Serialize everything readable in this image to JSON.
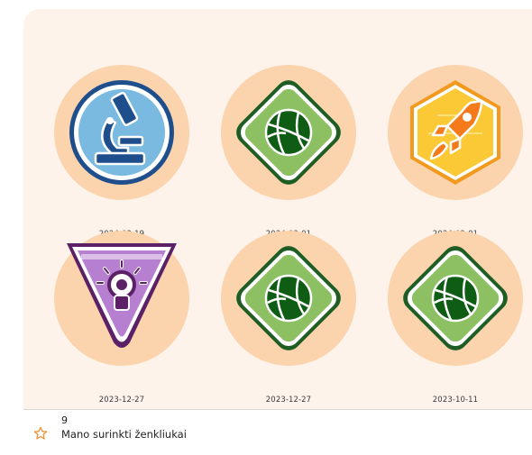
{
  "badges": [
    {
      "date": "2024-03-19",
      "icon": "microscope-icon"
    },
    {
      "date": "2024-03-01",
      "icon": "basketball-icon"
    },
    {
      "date": "2024-02-01",
      "icon": "rocket-icon"
    },
    {
      "date": "2023-12-27",
      "icon": "lightbulb-icon"
    },
    {
      "date": "2023-12-27",
      "icon": "basketball-icon"
    },
    {
      "date": "2023-10-11",
      "icon": "basketball-icon"
    }
  ],
  "footer": {
    "count": "9",
    "label": "Mano surinkti ženkliukai",
    "icon": "star-outline-icon"
  },
  "colors": {
    "card_background": "#fdf3ea",
    "badge_circle": "#fbd3ad",
    "star_accent": "#f08a24"
  }
}
